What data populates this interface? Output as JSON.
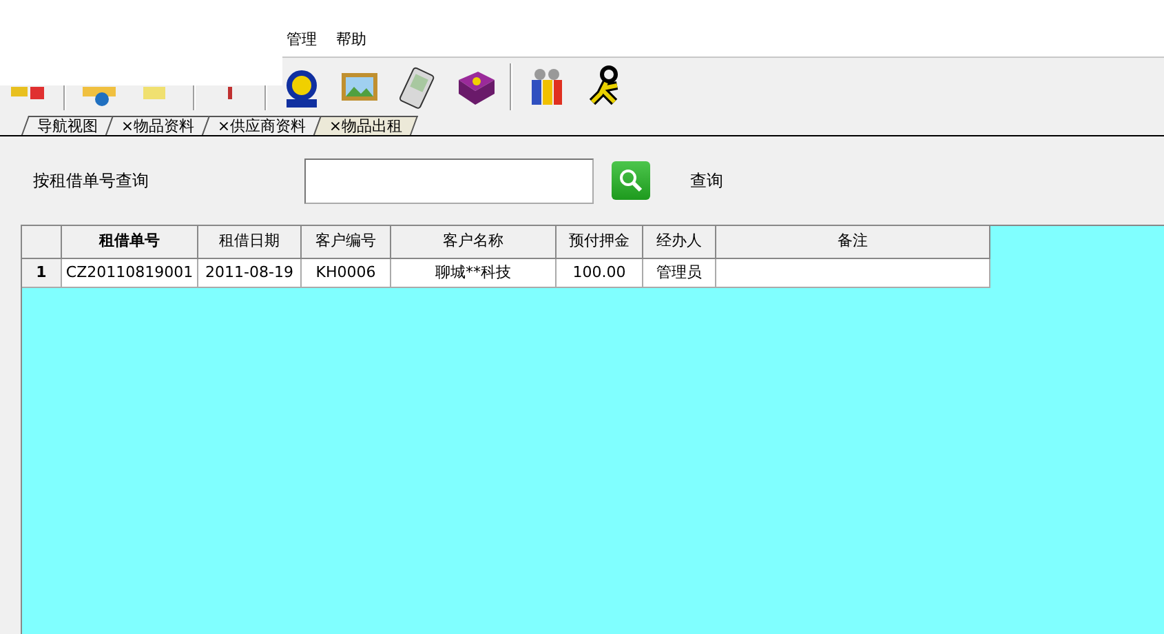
{
  "menu": [
    "管理",
    "帮助"
  ],
  "tabs": [
    {
      "label": "导航视图",
      "closable": false,
      "selected": false
    },
    {
      "label": "物品资料",
      "closable": true,
      "selected": false
    },
    {
      "label": "供应商资料",
      "closable": true,
      "selected": false
    },
    {
      "label": "物品出租",
      "closable": true,
      "selected": true
    }
  ],
  "tab_close_mark": "×",
  "search": {
    "label": "按租借单号查询",
    "button_label": "查询"
  },
  "table": {
    "columns": [
      {
        "label": "租借单号",
        "sorted": true
      },
      {
        "label": "租借日期",
        "sorted": false
      },
      {
        "label": "客户编号",
        "sorted": false
      },
      {
        "label": "客户名称",
        "sorted": false
      },
      {
        "label": "预付押金",
        "sorted": false
      },
      {
        "label": "经办人",
        "sorted": false
      },
      {
        "label": "备注",
        "sorted": false
      }
    ],
    "rows": [
      {
        "number": "1",
        "cells": [
          "CZ20110819001",
          "2011-08-19",
          "KH0006",
          "聊城**科技",
          "100.00",
          "管理员",
          ""
        ]
      }
    ]
  }
}
